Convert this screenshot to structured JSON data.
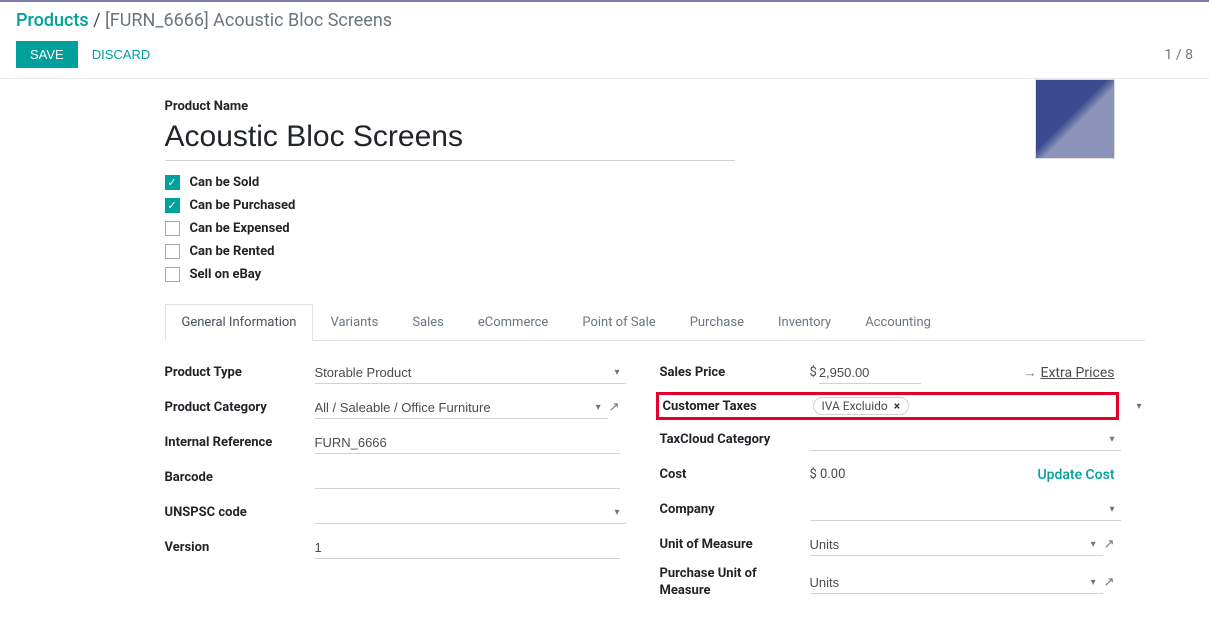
{
  "breadcrumb": {
    "root": "Products",
    "current": "[FURN_6666] Acoustic Bloc Screens"
  },
  "toolbar": {
    "save": "SAVE",
    "discard": "DISCARD",
    "pager": "1 / 8"
  },
  "name_label": "Product Name",
  "name_value": "Acoustic Bloc Screens",
  "checkboxes": {
    "sold": "Can be Sold",
    "purchased": "Can be Purchased",
    "expensed": "Can be Expensed",
    "rented": "Can be Rented",
    "ebay": "Sell on eBay"
  },
  "tabs": [
    "General Information",
    "Variants",
    "Sales",
    "eCommerce",
    "Point of Sale",
    "Purchase",
    "Inventory",
    "Accounting"
  ],
  "left": {
    "product_type_label": "Product Type",
    "product_type_value": "Storable Product",
    "category_label": "Product Category",
    "category_value": "All / Saleable / Office Furniture",
    "internal_ref_label": "Internal Reference",
    "internal_ref_value": "FURN_6666",
    "barcode_label": "Barcode",
    "barcode_value": "",
    "unspsc_label": "UNSPSC code",
    "unspsc_value": "",
    "version_label": "Version",
    "version_value": "1"
  },
  "right": {
    "sales_price_label": "Sales Price",
    "sales_price_currency": "$",
    "sales_price_value": "2,950.00",
    "extra_prices": "Extra Prices",
    "customer_taxes_label": "Customer Taxes",
    "customer_taxes_tag": "IVA Excluido",
    "taxcloud_label": "TaxCloud Category",
    "taxcloud_value": "",
    "cost_label": "Cost",
    "cost_value": "$ 0.00",
    "update_cost": "Update Cost",
    "company_label": "Company",
    "company_value": "",
    "uom_label": "Unit of Measure",
    "uom_value": "Units",
    "purchase_uom_label": "Purchase Unit of Measure",
    "purchase_uom_value": "Units"
  }
}
